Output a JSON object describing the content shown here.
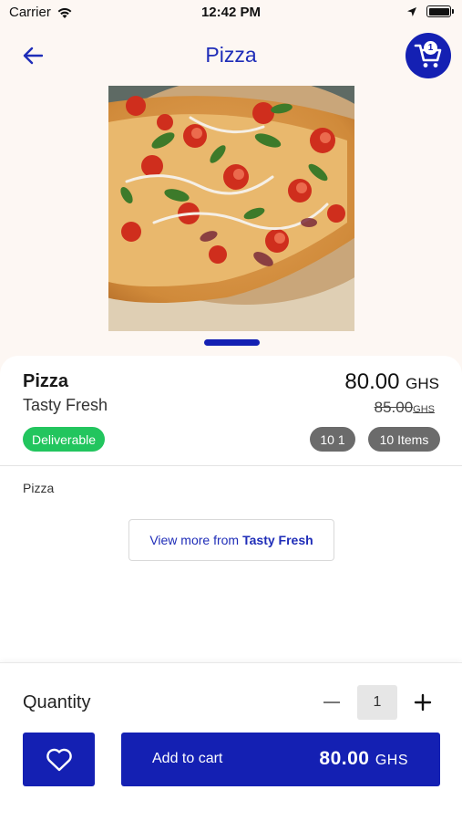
{
  "status_bar": {
    "carrier": "Carrier",
    "time": "12:42 PM"
  },
  "nav": {
    "title": "Pizza",
    "cart_count": "1"
  },
  "product": {
    "name": "Pizza",
    "vendor": "Tasty Fresh",
    "price": "80.00",
    "currency": "GHS",
    "old_price": "85.00",
    "old_currency": "GHS",
    "deliverable_label": "Deliverable",
    "chip_one": "10 1",
    "chip_two": "10 Items",
    "description": "Pizza",
    "view_more_prefix": "View more from",
    "view_more_vendor": "Tasty Fresh"
  },
  "purchase": {
    "quantity_label": "Quantity",
    "quantity_value": "1",
    "add_to_cart_label": "Add to cart",
    "total_price": "80.00",
    "total_currency": "GHS"
  },
  "colors": {
    "accent": "#1420b3",
    "deliverable": "#22c55e",
    "chip": "#6b6b6b"
  }
}
